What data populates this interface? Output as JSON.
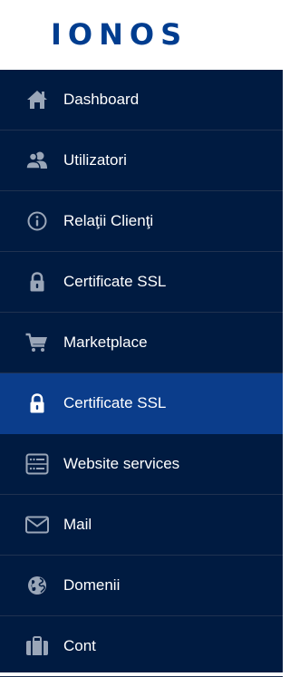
{
  "brand": {
    "logo_text": "IONOS"
  },
  "colors": {
    "brand": "#003d8f",
    "sidebar_bg": "#001b41",
    "active_bg": "#0b3d8b",
    "icon": "#9aa6b8",
    "icon_active": "#ffffff",
    "text": "#ffffff"
  },
  "sidebar": {
    "items": [
      {
        "label": "Dashboard",
        "icon": "home-icon"
      },
      {
        "label": "Utilizatori",
        "icon": "users-icon"
      },
      {
        "label": "Relaţii Clienţi",
        "icon": "info-icon"
      },
      {
        "label": "Certificate SSL",
        "icon": "lock-icon"
      },
      {
        "label": "Marketplace",
        "icon": "cart-icon"
      },
      {
        "label": "Certificate SSL",
        "icon": "lock-icon",
        "active": true
      },
      {
        "label": "Website services",
        "icon": "server-icon"
      },
      {
        "label": "Mail",
        "icon": "mail-icon"
      },
      {
        "label": "Domenii",
        "icon": "globe-icon"
      },
      {
        "label": "Cont",
        "icon": "briefcase-icon"
      }
    ]
  }
}
